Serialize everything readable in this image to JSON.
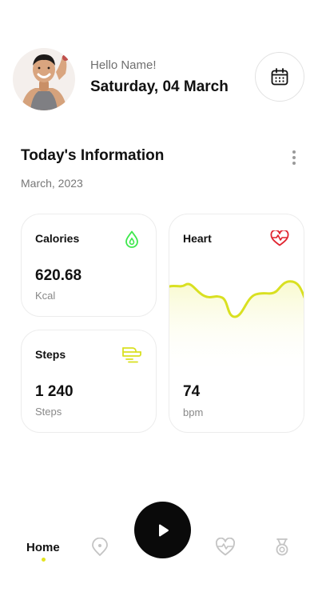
{
  "header": {
    "greeting": "Hello Name!",
    "date": "Saturday, 04 March"
  },
  "info": {
    "title": "Today's Information",
    "subtitle": "March, 2023"
  },
  "cards": {
    "calories": {
      "title": "Calories",
      "value": "620.68",
      "unit": "Kcal",
      "icon": "water-drop-icon"
    },
    "heart": {
      "title": "Heart",
      "value": "74",
      "unit": "bpm",
      "icon": "heart-pulse-icon"
    },
    "steps": {
      "title": "Steps",
      "value": "1 240",
      "unit": "Steps",
      "icon": "wind-icon"
    }
  },
  "colors": {
    "accent_yellow": "#d9e021",
    "calories_green": "#3ee84d",
    "heart_red": "#e0242f",
    "text_dark": "#111111",
    "text_muted": "#777777"
  },
  "nav": {
    "home_label": "Home",
    "items": [
      "home",
      "location-icon",
      "play-icon",
      "heart-icon",
      "medal-icon"
    ]
  }
}
